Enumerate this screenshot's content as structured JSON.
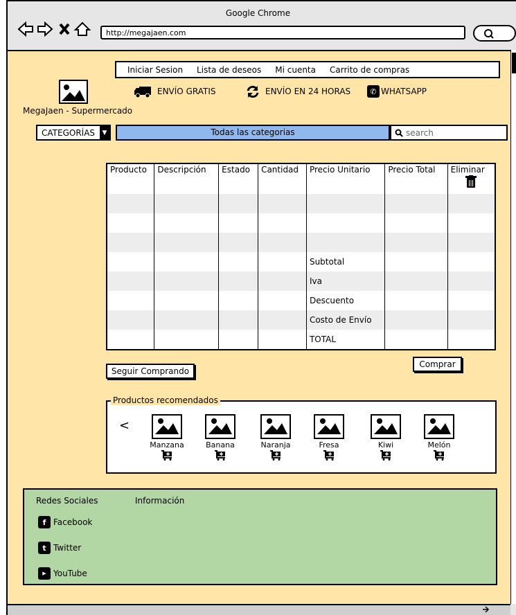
{
  "browser": {
    "title": "Google Chrome",
    "url": "http://megajaen.com"
  },
  "topnav": [
    "Iniciar Sesion",
    "Lista de deseos",
    "Mi cuenta",
    "Carrito de compras"
  ],
  "brand": {
    "name": "MegaJaen - Supermercado"
  },
  "shipping": {
    "free": "ENVÍO GRATIS",
    "fast": "ENVÍO EN 24 HORAS",
    "whatsapp": "WHATSAPP"
  },
  "filters": {
    "category_label": "CATEGORÍAS",
    "all_categories": "Todas las categorias",
    "search_placeholder": "search"
  },
  "cart": {
    "columns": [
      "Producto",
      "Descripción",
      "Estado",
      "Cantidad",
      "Precio Unitario",
      "Precio Total",
      "Eliminar"
    ],
    "summary": [
      "Subtotal",
      "Iva",
      "Descuento",
      "Costo de Envío",
      "TOTAL"
    ]
  },
  "actions": {
    "continue": "Seguir Comprando",
    "buy": "Comprar"
  },
  "recommended": {
    "title": "Productos recomendados",
    "prev": "<",
    "items": [
      "Manzana",
      "Banana",
      "Naranja",
      "Fresa",
      "Kiwi",
      "Melón"
    ]
  },
  "footer": {
    "social_title": "Redes Sociales",
    "info_title": "Información",
    "social": [
      "Facebook",
      "Twitter",
      "YouTube"
    ]
  }
}
